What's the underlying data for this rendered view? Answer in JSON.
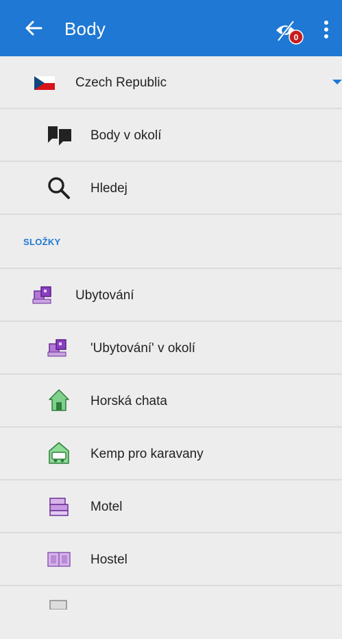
{
  "appbar": {
    "title": "Body",
    "badge_count": "0",
    "color": "#1e78d4"
  },
  "country": {
    "label": "Czech Republic"
  },
  "nearby": {
    "label": "Body v okolí"
  },
  "search": {
    "label": "Hledej"
  },
  "section": {
    "label": "SLOŽKY"
  },
  "items": [
    {
      "label": "Ubytování",
      "icon": "accommodation-icon"
    },
    {
      "label": "'Ubytování' v okolí",
      "icon": "accommodation-icon"
    },
    {
      "label": "Horská chata",
      "icon": "mountain-hut-icon"
    },
    {
      "label": "Kemp pro karavany",
      "icon": "caravan-camp-icon"
    },
    {
      "label": "Motel",
      "icon": "motel-icon"
    },
    {
      "label": "Hostel",
      "icon": "hostel-icon"
    }
  ]
}
